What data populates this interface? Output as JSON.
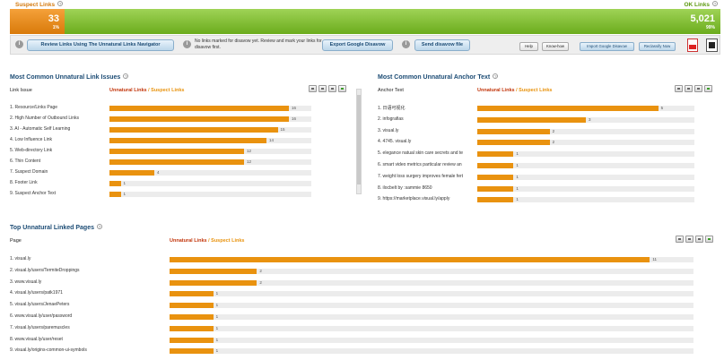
{
  "header": {
    "suspect_label": "Suspect Links",
    "ok_label": "OK Links",
    "suspect_count": "33",
    "suspect_pct": "1%",
    "ok_count": "5,021",
    "ok_pct": "99%"
  },
  "toolbar": {
    "review_button": "Review Links Using The Unnatural Links Navigator",
    "note": "No links marked for disavow yet. Review and mark your links for disavow first.",
    "export_button": "Export Google Disavow",
    "send_button": "Send disavow file",
    "help_button": "Help",
    "knowhow_button": "Know-how",
    "import_button": "Import Google Disavow",
    "reclassify_button": "Reclassify Now"
  },
  "colors": {
    "suspect": "#e9920f",
    "ok": "#7cbf2b",
    "title": "#1b4b74"
  },
  "panel_issues": {
    "title": "Most Common Unnatural Link Issues",
    "col_label": "Link Issue",
    "legend_unnatural": "Unnatural Links",
    "legend_sep": " / ",
    "legend_suspect": "Suspect Links",
    "max": 18,
    "rows": [
      {
        "label": "1. Resource/Links Page",
        "value": 16
      },
      {
        "label": "2. High Number of Outbound Links",
        "value": 16
      },
      {
        "label": "3. AI - Automatic Self Learning",
        "value": 15
      },
      {
        "label": "4. Low Influence Link",
        "value": 14
      },
      {
        "label": "5. Web-directory Link",
        "value": 12
      },
      {
        "label": "6. Thin Content",
        "value": 12
      },
      {
        "label": "7. Suspect Domain",
        "value": 4
      },
      {
        "label": "8. Footer Link",
        "value": 1
      },
      {
        "label": "9. Suspect Anchor Text",
        "value": 1
      }
    ]
  },
  "panel_anchor": {
    "title": "Most Common Unnatural Anchor Text",
    "col_label": "Anchor Text",
    "legend_unnatural": "Unnatural Links",
    "legend_sep": " / ",
    "legend_suspect": "Suspect Links",
    "max": 6,
    "rows": [
      {
        "label": "1. 日语可视化",
        "value": 5
      },
      {
        "label": "2. infografias",
        "value": 3
      },
      {
        "label": "3. visual.ly",
        "value": 2
      },
      {
        "label": "4. 4745. visual.ly",
        "value": 2
      },
      {
        "label": "5. elegance natual skin care secrets and te",
        "value": 1
      },
      {
        "label": "6. smart video metrics particular review an",
        "value": 1
      },
      {
        "label": "7. weight loss surgery improves female fert",
        "value": 1
      },
      {
        "label": "8. ilocbelt by :sammie 8650",
        "value": 1
      },
      {
        "label": "9. https://marketplace.visual.ly/apply",
        "value": 1
      }
    ]
  },
  "panel_pages": {
    "title": "Top Unnatural Linked Pages",
    "col_label": "Page",
    "legend_unnatural": "Unnatural Links",
    "legend_sep": " / ",
    "legend_suspect": "Suspect Links",
    "max": 12,
    "rows": [
      {
        "label": "1. visual.ly",
        "value": 11
      },
      {
        "label": "2. visual.ly/users/TermiteDroppings",
        "value": 2
      },
      {
        "label": "3. www.visual.ly",
        "value": 2
      },
      {
        "label": "4. visual.ly/users/patk1971",
        "value": 1
      },
      {
        "label": "5. visual.ly/users/JenaePeters",
        "value": 1
      },
      {
        "label": "6. www.visual.ly/user/password",
        "value": 1
      },
      {
        "label": "7. visual.ly/users/paremuscles",
        "value": 1
      },
      {
        "label": "8. www.visual.ly/user/reset",
        "value": 1
      },
      {
        "label": "9. visual.ly/origins-common-ui-symbols",
        "value": 1
      }
    ]
  }
}
